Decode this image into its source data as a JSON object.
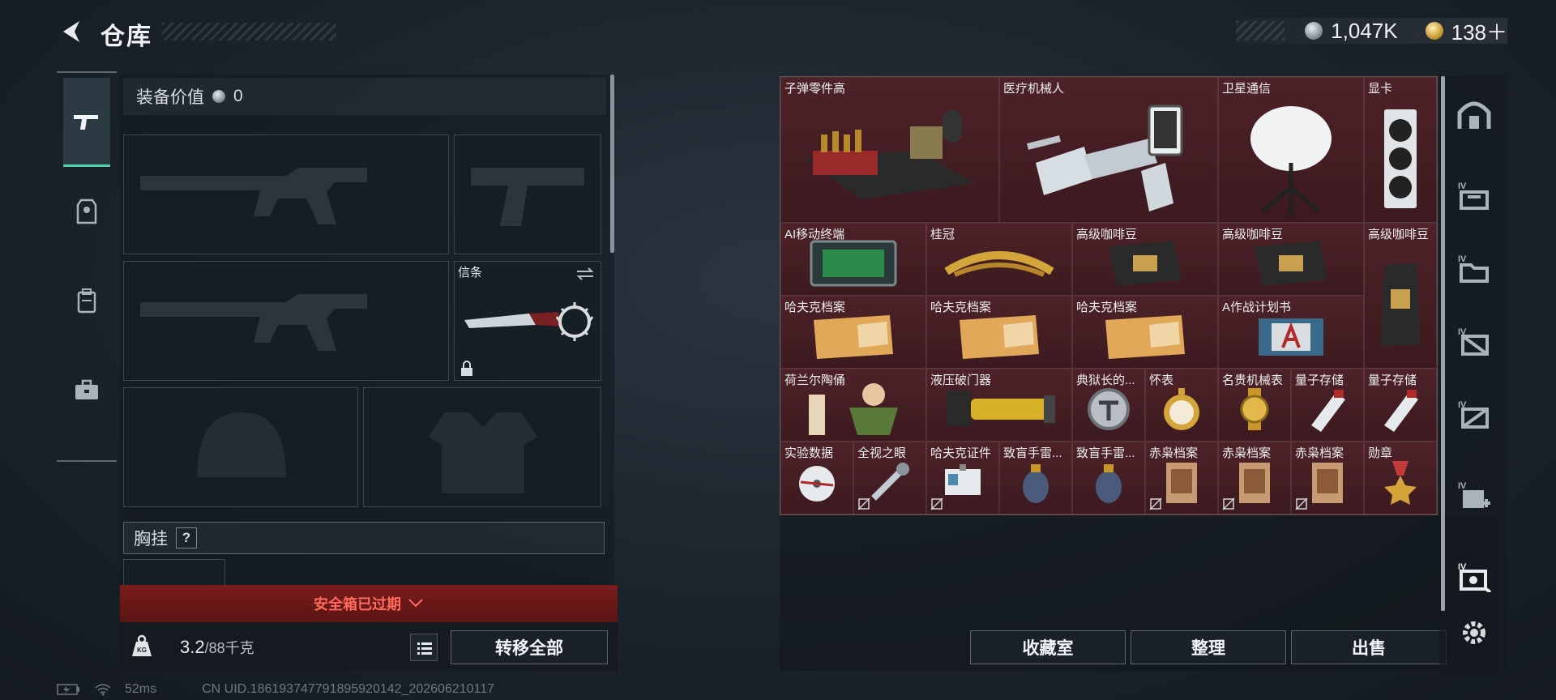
{
  "header": {
    "title": "仓库",
    "silver_amount": "1,047K",
    "gold_amount": "138＋"
  },
  "loadout": {
    "value_label": "装备价值",
    "value_amount": "0",
    "knife_slot_label": "信条",
    "chest_rig_label": "胸挂",
    "chest_rig_help": "?",
    "safebox_expired": "安全箱已过期",
    "weight_current": "3.2",
    "weight_max": "/88千克",
    "weight_icon_text": "KG",
    "transfer_all": "转移全部"
  },
  "status_bar": {
    "ping": "52ms",
    "uid": "CN UID.186193747791895920142_202606210117"
  },
  "grid_items": [
    {
      "label": "子弹零件高",
      "rarity": "red"
    },
    {
      "label": "医疗机械人",
      "rarity": "red"
    },
    {
      "label": "卫星通信",
      "rarity": "red"
    },
    {
      "label": "显卡",
      "rarity": "red"
    },
    {
      "label": "AI移动终端",
      "rarity": "red"
    },
    {
      "label": "桂冠",
      "rarity": "red"
    },
    {
      "label": "高级咖啡豆",
      "rarity": "red"
    },
    {
      "label": "高级咖啡豆",
      "rarity": "red"
    },
    {
      "label": "高级咖啡豆",
      "rarity": "red"
    },
    {
      "label": "哈夫克档案",
      "rarity": "red"
    },
    {
      "label": "哈夫克档案",
      "rarity": "red"
    },
    {
      "label": "哈夫克档案",
      "rarity": "red"
    },
    {
      "label": "A作战计划书",
      "rarity": "red"
    },
    {
      "label": "荷兰尔陶俑",
      "rarity": "red"
    },
    {
      "label": "液压破门器",
      "rarity": "red"
    },
    {
      "label": "典狱长的...",
      "rarity": "red"
    },
    {
      "label": "怀表",
      "rarity": "red"
    },
    {
      "label": "名贵机械表",
      "rarity": "red"
    },
    {
      "label": "量子存储",
      "rarity": "red"
    },
    {
      "label": "量子存储",
      "rarity": "red"
    },
    {
      "label": "实验数据",
      "rarity": "red"
    },
    {
      "label": "全视之眼",
      "rarity": "red"
    },
    {
      "label": "哈夫克证件",
      "rarity": "red"
    },
    {
      "label": "致盲手雷...",
      "rarity": "red"
    },
    {
      "label": "致盲手雷...",
      "rarity": "red"
    },
    {
      "label": "赤枭档案",
      "rarity": "red"
    },
    {
      "label": "赤枭档案",
      "rarity": "red"
    },
    {
      "label": "赤枭档案",
      "rarity": "red"
    },
    {
      "label": "勋章",
      "rarity": "red"
    }
  ],
  "actions": {
    "collection": "收藏室",
    "sort": "整理",
    "sell": "出售"
  },
  "colors": {
    "accent": "#4ed2a6",
    "red_rarity": "#4d2228",
    "danger": "#ff6a5c"
  }
}
